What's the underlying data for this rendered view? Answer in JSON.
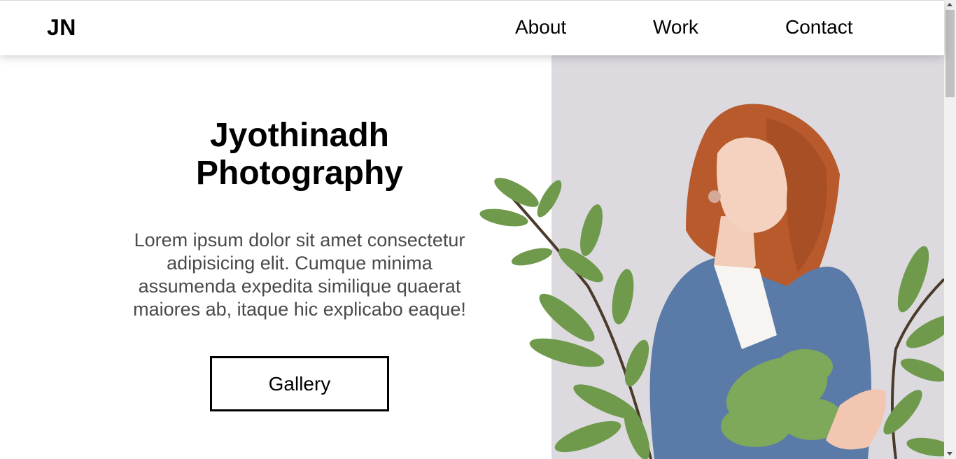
{
  "nav": {
    "logo": "JN",
    "links": [
      "About",
      "Work",
      "Contact"
    ]
  },
  "hero": {
    "title": "Jyothinadh Photography",
    "description": "Lorem ipsum dolor sit amet consectetur adipisicing elit. Cumque minima assumenda expedita similique quaerat maiores ab, itaque hic explicabo eaque!",
    "button_label": "Gallery",
    "photo_icon": "woman-with-plants-photo"
  },
  "colors": {
    "photo_background": "#dcdadf",
    "sweater": "#5a7aa8",
    "hair": "#b85a2c",
    "leaves": "#6f9a4c",
    "description_text": "#4a4a4a"
  }
}
